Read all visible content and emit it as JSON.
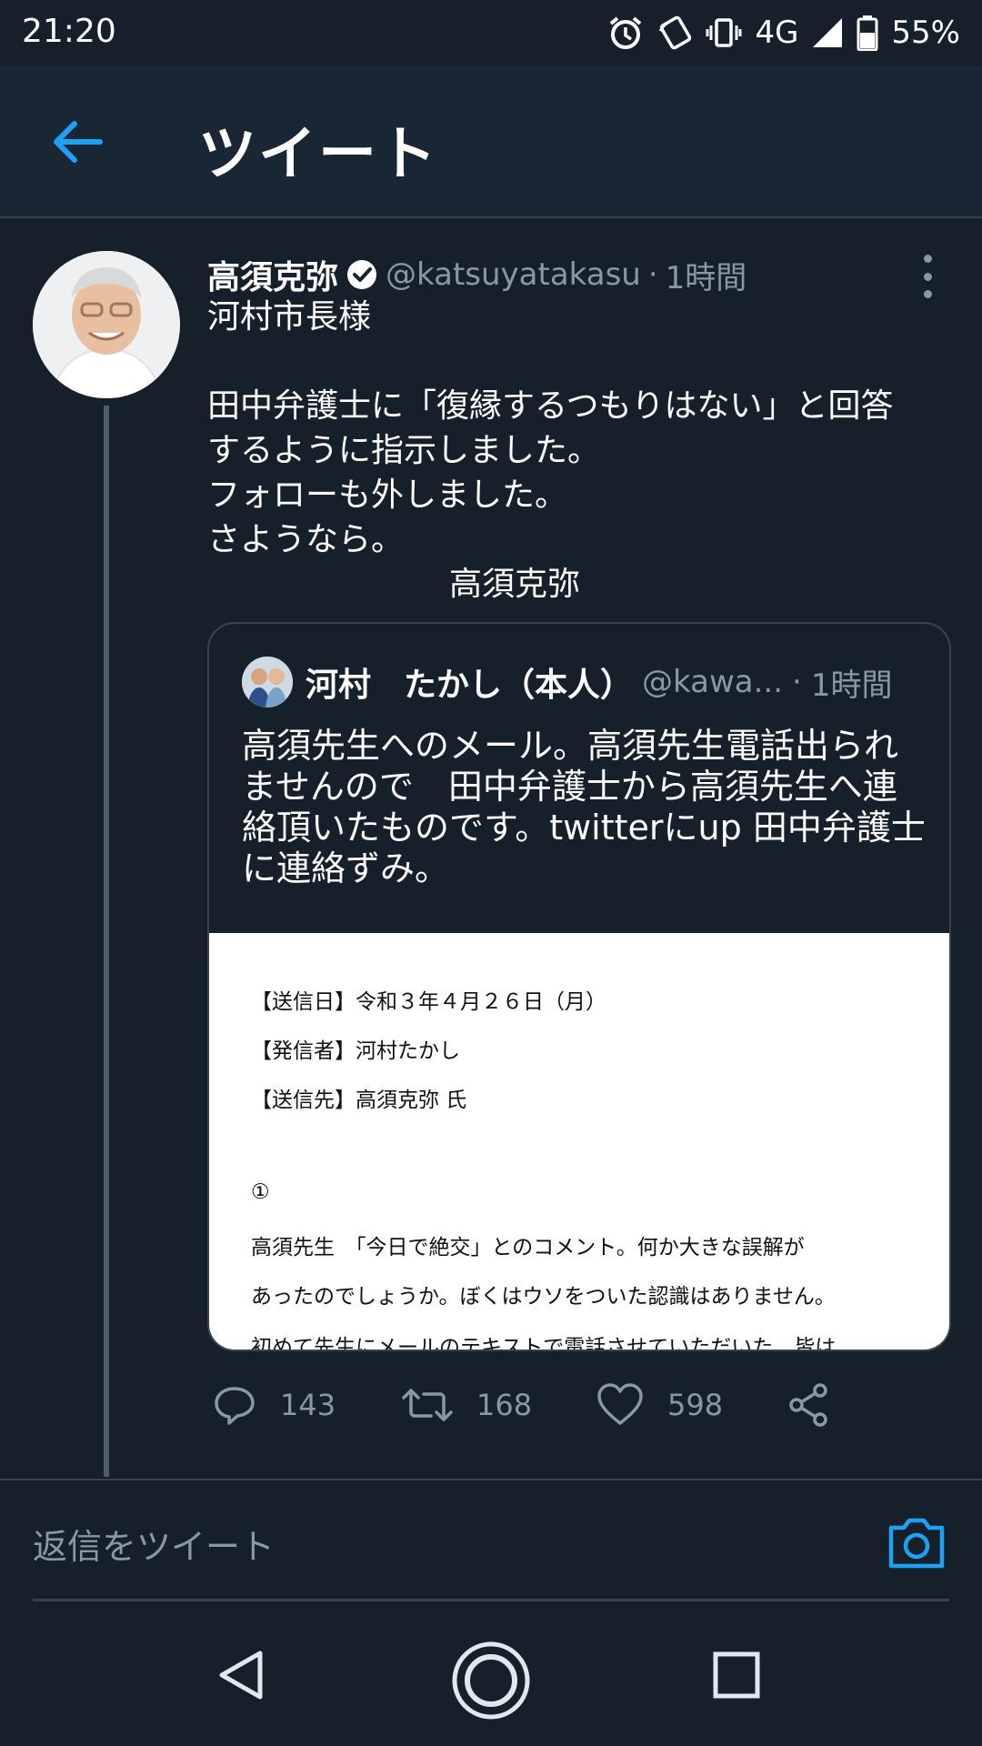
{
  "status_bar": {
    "time": "21:20",
    "network": "4G",
    "battery": "55%",
    "icons": [
      "alarm-icon",
      "nfc-icon",
      "vibrate-icon",
      "signal-icon",
      "battery-icon"
    ]
  },
  "app_bar": {
    "title": "ツイート",
    "back_icon": "arrow-left-icon"
  },
  "tweet": {
    "author_name": "高須克弥",
    "handle": "@katsuyatakasu",
    "separator": "·",
    "time": "1時間",
    "body_lines": [
      "河村市長様",
      "",
      "田中弁護士に「復縁するつもりはない」と回答",
      "するように指示しました。",
      "フォローも外しました。",
      "さようなら。",
      "高須克弥"
    ],
    "quote": {
      "author_name": "河村　たかし（本人）",
      "handle": "@kawa...",
      "separator": "·",
      "time": "1時間",
      "body_lines": [
        "高須先生へのメール。高須先生電話出られ",
        "ませんので　田中弁護士から高須先生へ連",
        "絡頂いたものです。twitterにup 田中弁護士",
        "に連絡ずみ。"
      ],
      "document_lines": [
        "【送信日】令和３年４月２６日（月）",
        "【発信者】河村たかし",
        "【送信先】高須克弥 氏",
        "①",
        "高須先生　「今日で絶交」とのコメント。何か大きな誤解が",
        "あったのでしょうか。ぼくはウソをついた認識はありません。",
        "初めて先生にメールのテキストで電話させていただいた。皆は"
      ]
    },
    "actions": {
      "replies": "143",
      "retweets": "168",
      "likes": "598"
    }
  },
  "reply_bar": {
    "placeholder": "返信をツイート"
  },
  "colors": {
    "background": "#15202b",
    "header_background": "#192734",
    "accent": "#1da1f2",
    "muted_text": "#8899a6",
    "border": "#38444d"
  }
}
